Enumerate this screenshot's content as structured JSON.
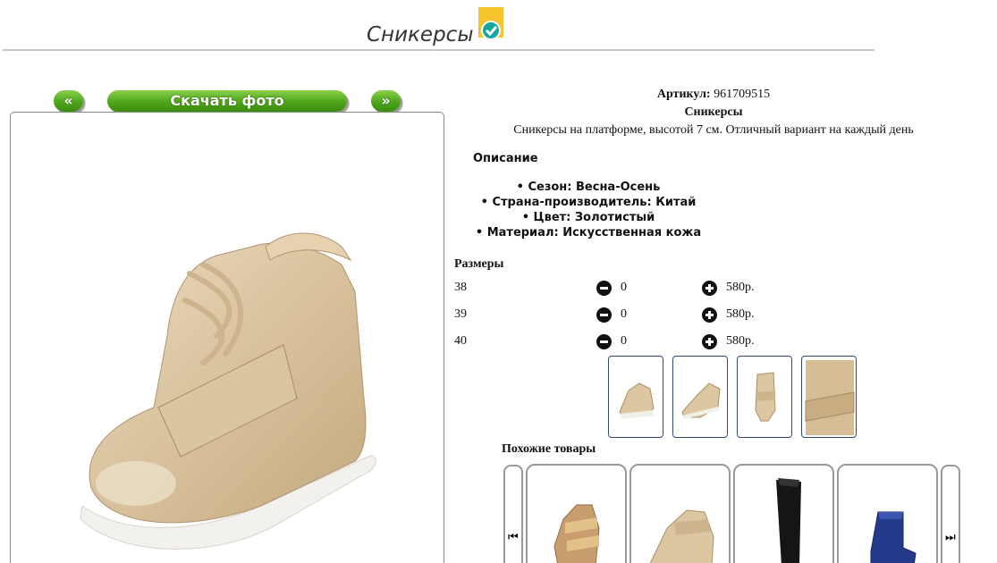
{
  "header": {
    "title": "Сникерсы"
  },
  "gallery": {
    "prev_label": "«",
    "next_label": "»",
    "download_label": "Скачать фото"
  },
  "product": {
    "article_label": "Артикул:",
    "article_value": "961709515",
    "name": "Сникерсы",
    "description": "Сникерсы на платформе, высотой 7 см. Отличный вариант на каждый день"
  },
  "description_section": {
    "heading": "Описание",
    "properties": [
      "• Сезон: Весна-Осень",
      "• Страна-производитель: Китай",
      "• Цвет: Золотистый",
      "• Материал: Искусственная кожа"
    ]
  },
  "sizes": {
    "heading": "Размеры",
    "rows": [
      {
        "size": "38",
        "qty": "0",
        "price": "580р."
      },
      {
        "size": "39",
        "qty": "0",
        "price": "580р."
      },
      {
        "size": "40",
        "qty": "0",
        "price": "580р."
      }
    ]
  },
  "similar": {
    "heading": "Похожие товары",
    "prev_icon": "⏮",
    "next_icon": "⏭"
  },
  "colors": {
    "accent_green": "#4ea61a",
    "badge_yellow": "#f6c32a",
    "badge_teal": "#15a7a0",
    "thumb_border": "#2c4b78"
  }
}
